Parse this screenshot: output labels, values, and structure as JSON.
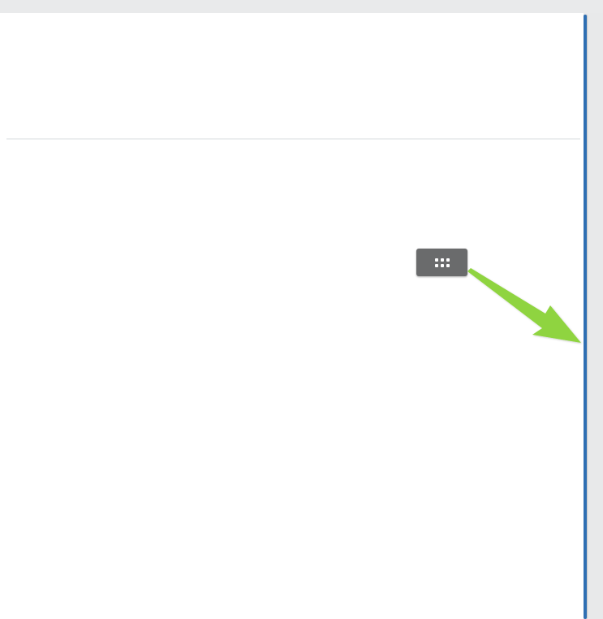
{
  "window": {
    "title": ""
  },
  "resize_handle": {
    "icon": "grip-dots-icon",
    "label": ""
  },
  "annotation": {
    "type": "arrow",
    "color": "#8fd43f",
    "points_to": "panel-splitter"
  },
  "colors": {
    "splitter": "#2f6fb3",
    "handle_background": "#6a6b6c",
    "gutter": "#e8e9ea",
    "arrow": "#8fd43f"
  }
}
